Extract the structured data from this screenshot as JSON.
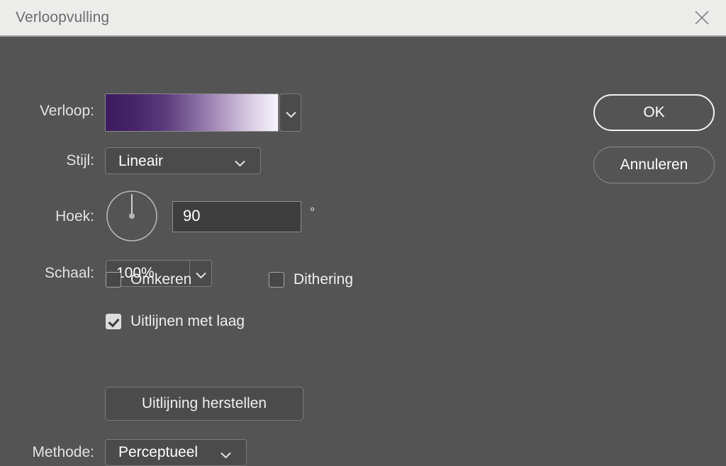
{
  "window": {
    "title": "Verloopvulling",
    "close_icon": "close-icon"
  },
  "form": {
    "gradient": {
      "label": "Verloop:",
      "stops": [
        "#3c1a5e",
        "#f6f2fa"
      ],
      "dropdown_icon": "chevron-down-icon"
    },
    "style": {
      "label": "Stijl:",
      "value": "Lineair",
      "dropdown_icon": "chevron-down-icon"
    },
    "angle": {
      "label": "Hoek:",
      "value": "90",
      "unit": "°",
      "dial_icon": "angle-dial-icon"
    },
    "scale": {
      "label": "Schaal:",
      "value": "100%",
      "dropdown_icon": "chevron-down-icon"
    },
    "reverse": {
      "label": "Omkeren",
      "checked": false
    },
    "dithering": {
      "label": "Dithering",
      "checked": false
    },
    "align_with_layer": {
      "label": "Uitlijnen met laag",
      "checked": true
    },
    "reset_alignment": {
      "label": "Uitlijning herstellen"
    },
    "method": {
      "label": "Methode:",
      "value": "Perceptueel",
      "dropdown_icon": "chevron-down-icon"
    }
  },
  "actions": {
    "ok": "OK",
    "cancel": "Annuleren"
  },
  "colors": {
    "dialog_background": "#545454",
    "titlebar_background": "#ececeb",
    "text": "#efefef",
    "gradient_start": "#3c1a5e",
    "gradient_end": "#f6f2fa"
  }
}
